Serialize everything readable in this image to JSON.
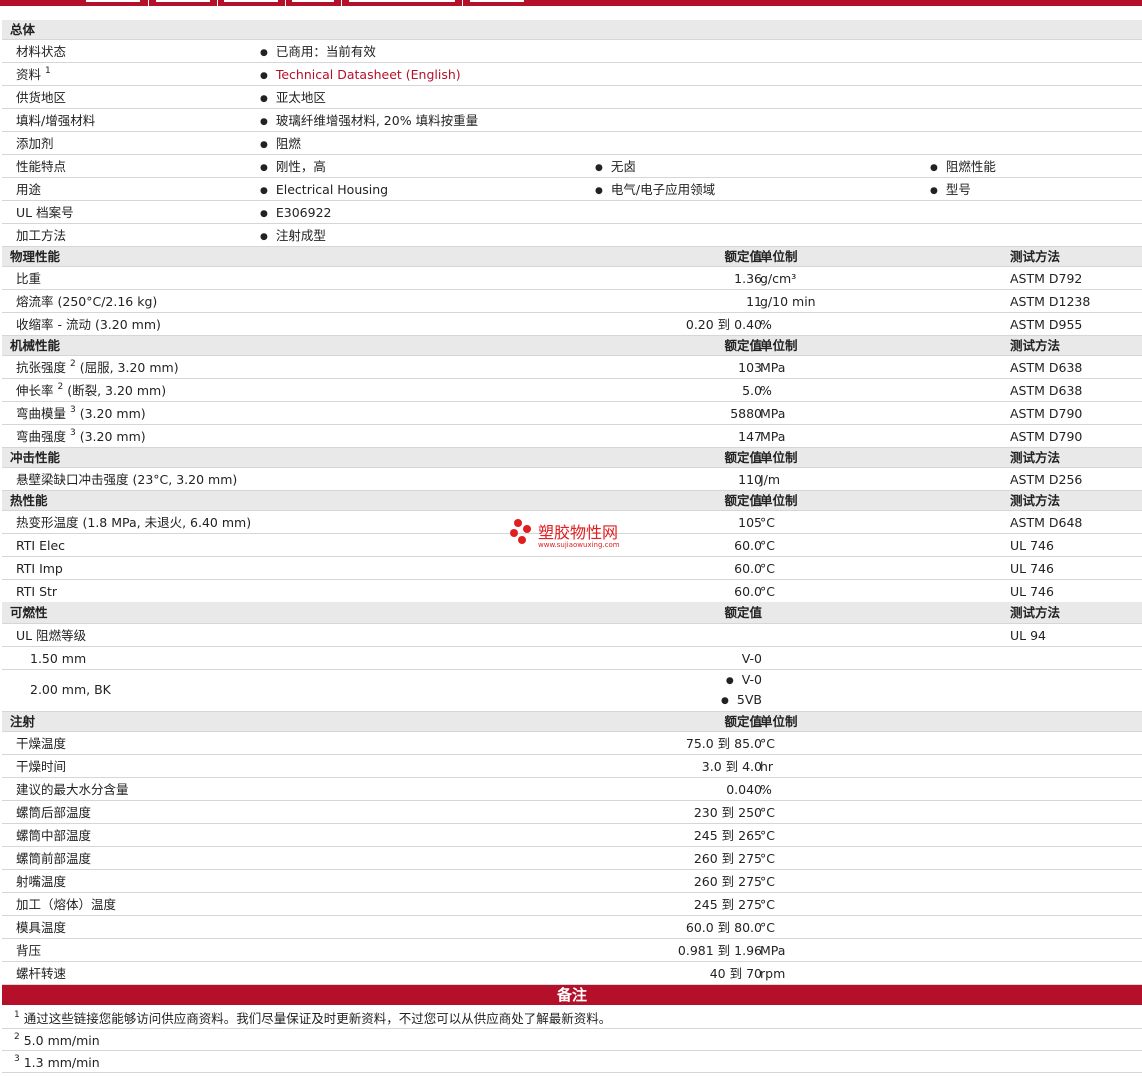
{
  "general": {
    "title": "总体",
    "status_label": "材料状态",
    "status_value": "已商用：当前有效",
    "docs_label": "资料",
    "docs_sup": "1",
    "docs_value": "Technical Datasheet (English)",
    "region_label": "供货地区",
    "region_value": "亚太地区",
    "filler_label": "填料/增强材料",
    "filler_value": "玻璃纤维增强材料, 20% 填料按重量",
    "additive_label": "添加剂",
    "additive_value": "阻燃",
    "features_label": "性能特点",
    "features": [
      "刚性，高",
      "无卤",
      "阻燃性能"
    ],
    "uses_label": "用途",
    "uses": [
      "Electrical Housing",
      "电气/电子应用领域",
      "型号"
    ],
    "ul_label": "UL 档案号",
    "ul_value": "E306922",
    "process_label": "加工方法",
    "process_value": "注射成型"
  },
  "cols": {
    "nominal": "额定值",
    "unit": "单位制",
    "test": "测试方法"
  },
  "physical": {
    "title": "物理性能",
    "rows": [
      {
        "label": "比重",
        "sup": "",
        "cond": "",
        "value": "1.36",
        "unit": "g/cm³",
        "test": "ASTM D792"
      },
      {
        "label": "熔流率",
        "sup": "",
        "cond": "(250°C/2.16 kg)",
        "value": "11",
        "unit": "g/10 min",
        "test": "ASTM D1238"
      },
      {
        "label": "收缩率",
        "sup": "",
        "cond": "- 流动  (3.20 mm)",
        "value": "0.20 到  0.40",
        "unit": "%",
        "test": "ASTM D955"
      }
    ]
  },
  "mechanical": {
    "title": "机械性能",
    "rows": [
      {
        "label": "抗张强度",
        "sup": "2",
        "cond": "(屈服, 3.20 mm)",
        "value": "103",
        "unit": "MPa",
        "test": "ASTM D638"
      },
      {
        "label": "伸长率",
        "sup": "2",
        "cond": "(断裂, 3.20 mm)",
        "value": "5.0",
        "unit": "%",
        "test": "ASTM D638"
      },
      {
        "label": "弯曲模量",
        "sup": "3",
        "cond": "(3.20 mm)",
        "value": "5880",
        "unit": "MPa",
        "test": "ASTM D790"
      },
      {
        "label": "弯曲强度",
        "sup": "3",
        "cond": "(3.20 mm)",
        "value": "147",
        "unit": "MPa",
        "test": "ASTM D790"
      }
    ]
  },
  "impact": {
    "title": "冲击性能",
    "rows": [
      {
        "label": "悬壁梁缺口冲击强度",
        "sup": "",
        "cond": "(23°C, 3.20 mm)",
        "value": "110",
        "unit": "J/m",
        "test": "ASTM D256"
      }
    ]
  },
  "thermal": {
    "title": "热性能",
    "rows": [
      {
        "label": "热变形温度",
        "sup": "",
        "cond": "(1.8 MPa, 未退火, 6.40 mm)",
        "value": "105",
        "unit": "°C",
        "test": "ASTM D648"
      },
      {
        "label": "RTI Elec",
        "sup": "",
        "cond": "",
        "value": "60.0",
        "unit": "°C",
        "test": "UL 746"
      },
      {
        "label": "RTI Imp",
        "sup": "",
        "cond": "",
        "value": "60.0",
        "unit": "°C",
        "test": "UL 746"
      },
      {
        "label": "RTI Str",
        "sup": "",
        "cond": "",
        "value": "60.0",
        "unit": "°C",
        "test": "UL 746"
      }
    ]
  },
  "flammability": {
    "title": "可燃性",
    "ul_rating_label": "UL 阻燃等级",
    "ul_rating_test": "UL 94",
    "r1_label": "1.50 mm",
    "r1_value": "V-0",
    "r2_label": "2.00 mm, BK",
    "r2_values": [
      "V-0",
      "5VB"
    ]
  },
  "injection": {
    "title": "注射",
    "rows": [
      {
        "label": "干燥温度",
        "value": "75.0 到  85.0",
        "unit": "°C"
      },
      {
        "label": "干燥时间",
        "value": "3.0 到  4.0",
        "unit": "hr"
      },
      {
        "label": "建议的最大水分含量",
        "value": "0.040",
        "unit": "%"
      },
      {
        "label": "螺筒后部温度",
        "value": "230 到  250",
        "unit": "°C"
      },
      {
        "label": "螺筒中部温度",
        "value": "245 到  265",
        "unit": "°C"
      },
      {
        "label": "螺筒前部温度",
        "value": "260 到  275",
        "unit": "°C"
      },
      {
        "label": "射嘴温度",
        "value": "260 到  275",
        "unit": "°C"
      },
      {
        "label": "加工（熔体）温度",
        "value": "245 到  275",
        "unit": "°C"
      },
      {
        "label": "模具温度",
        "value": "60.0 到  80.0",
        "unit": "°C"
      },
      {
        "label": "背压",
        "value": "0.981 到  1.96",
        "unit": "MPa"
      },
      {
        "label": "螺杆转速",
        "value": "40 到  70",
        "unit": "rpm"
      }
    ]
  },
  "notes": {
    "title": "备注",
    "items": [
      {
        "num": "1",
        "text": "通过这些链接您能够访问供应商资料。我们尽量保证及时更新资料，不过您可以从供应商处了解最新资料。"
      },
      {
        "num": "2",
        "text": "5.0 mm/min"
      },
      {
        "num": "3",
        "text": "1.3 mm/min"
      }
    ]
  },
  "watermark": {
    "name": "塑胶物性网",
    "url": "www.sujiaowuxing.com"
  },
  "colors": {
    "accent": "#b5102a",
    "section_bg": "#e9e9e9"
  }
}
